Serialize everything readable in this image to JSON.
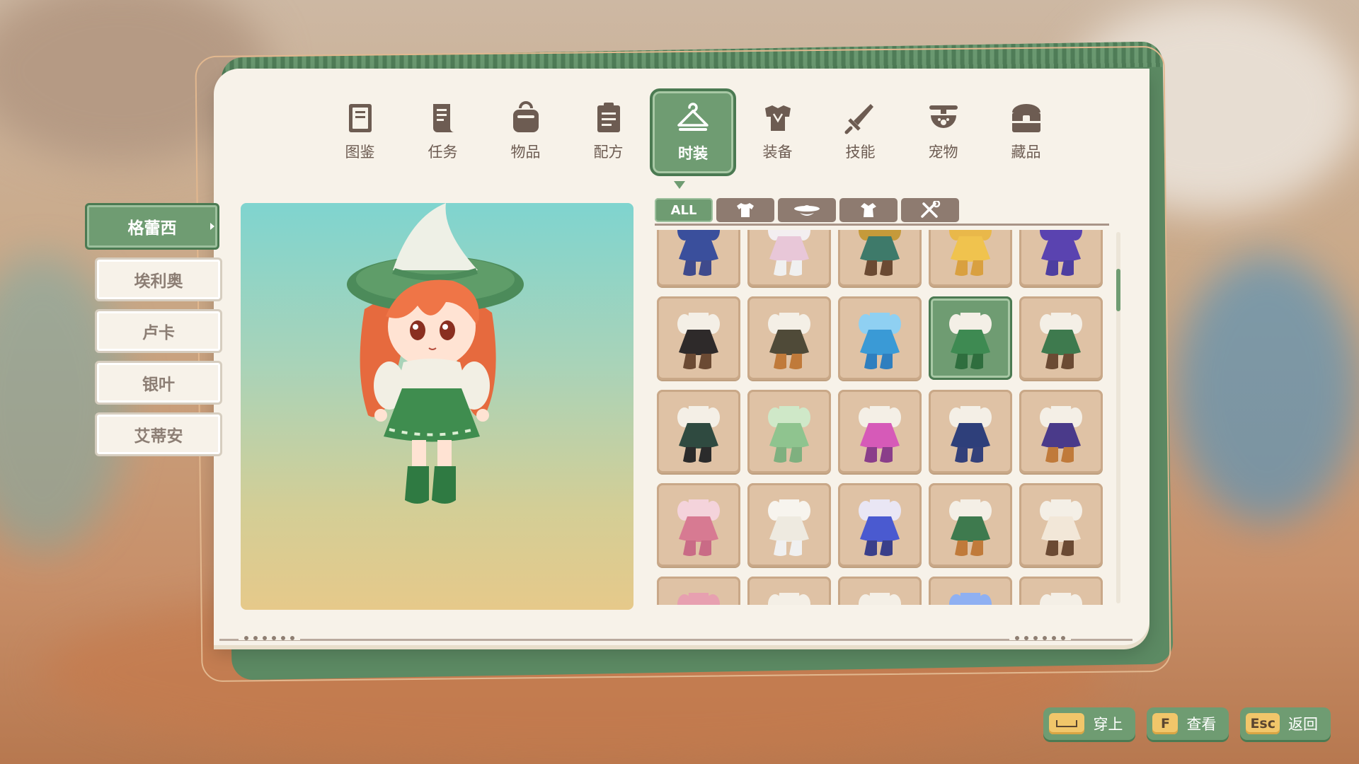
{
  "nav": {
    "items": [
      {
        "label": "图鉴",
        "icon": "book-icon"
      },
      {
        "label": "任务",
        "icon": "scroll-icon"
      },
      {
        "label": "物品",
        "icon": "bag-icon"
      },
      {
        "label": "配方",
        "icon": "clipboard-icon"
      },
      {
        "label": "时装",
        "icon": "hanger-icon",
        "active": true
      },
      {
        "label": "装备",
        "icon": "armor-icon"
      },
      {
        "label": "技能",
        "icon": "sword-icon"
      },
      {
        "label": "宠物",
        "icon": "pet-bowl-icon"
      },
      {
        "label": "藏品",
        "icon": "chest-icon"
      }
    ]
  },
  "characters": [
    {
      "name": "格蕾西",
      "active": true
    },
    {
      "name": "埃利奥"
    },
    {
      "name": "卢卡"
    },
    {
      "name": "银叶"
    },
    {
      "name": "艾蒂安"
    }
  ],
  "category_tabs": [
    {
      "label": "ALL",
      "active": true
    },
    {
      "icon": "shirt-icon"
    },
    {
      "icon": "hat-mask-icon"
    },
    {
      "icon": "outfit-icon"
    },
    {
      "icon": "tools-icon"
    }
  ],
  "outfits": [
    {
      "top": "#3a4f9c",
      "skirt": "#3a4f9c",
      "boots": "#3f4a8c"
    },
    {
      "top": "#f3eef0",
      "skirt": "#e8c7d8",
      "boots": "#f0f0f0"
    },
    {
      "top": "#c59a3a",
      "skirt": "#3e7a6a",
      "boots": "#6b4a33"
    },
    {
      "top": "#e9b84a",
      "skirt": "#f0c34e",
      "boots": "#d9a040"
    },
    {
      "top": "#5a43b0",
      "skirt": "#5a43b0",
      "boots": "#4d3ea0"
    },
    {
      "top": "#f4efe6",
      "skirt": "#2e2a2a",
      "boots": "#6b4a33"
    },
    {
      "top": "#f4efe6",
      "skirt": "#4f4a38",
      "boots": "#c07a3a"
    },
    {
      "top": "#8fd0f2",
      "skirt": "#3a9ad6",
      "boots": "#2f7fbf"
    },
    {
      "top": "#f4efe6",
      "skirt": "#3e8a52",
      "boots": "#2f6e3e",
      "selected": true
    },
    {
      "top": "#f4efe6",
      "skirt": "#3e7a4e",
      "boots": "#6b4a33"
    },
    {
      "top": "#f4efe6",
      "skirt": "#2f4a40",
      "boots": "#2b2b2b"
    },
    {
      "top": "#cfe8c8",
      "skirt": "#8fc48f",
      "boots": "#7fb07f"
    },
    {
      "top": "#f4efe6",
      "skirt": "#d65ab8",
      "boots": "#8a3e8a"
    },
    {
      "top": "#f4efe6",
      "skirt": "#2e3f7a",
      "boots": "#33407a"
    },
    {
      "top": "#f4efe6",
      "skirt": "#4a3a8a",
      "boots": "#c07a3a"
    },
    {
      "top": "#f4d3db",
      "skirt": "#d77a92",
      "boots": "#c96b86"
    },
    {
      "top": "#f7f4ee",
      "skirt": "#eeeae0",
      "boots": "#f0f0f0"
    },
    {
      "top": "#e9e6f4",
      "skirt": "#4a5ad0",
      "boots": "#3a3f8a"
    },
    {
      "top": "#f4efe6",
      "skirt": "#3e7a4e",
      "boots": "#c07a3a"
    },
    {
      "top": "#f4efe6",
      "skirt": "#f2e7d8",
      "boots": "#6b4a33"
    },
    {
      "top": "#e7a0b0",
      "skirt": "#e7a0b0",
      "boots": "#c96b86"
    },
    {
      "top": "#f4efe6",
      "skirt": "#6b4a33",
      "boots": "#6b4a33"
    },
    {
      "top": "#f4efe6",
      "skirt": "#d0d0d0",
      "boots": "#d0d0d0"
    },
    {
      "top": "#8fb0f2",
      "skirt": "#8fb0f2",
      "boots": "#3a3f8a"
    },
    {
      "top": "#f4efe6",
      "skirt": "#3a2a2a",
      "boots": "#6b4a33"
    }
  ],
  "hotkeys": [
    {
      "key": "",
      "label": "穿上",
      "key_icon": "space-key-icon"
    },
    {
      "key": "F",
      "label": "查看"
    },
    {
      "key": "Esc",
      "label": "返回"
    }
  ],
  "colors": {
    "accent_green": "#6f9c72",
    "panel": "#f7f2e9",
    "tab_brown": "#8e7b70",
    "cell_tan": "#dfc2a5",
    "hotkey_yellow": "#f1c66a"
  }
}
